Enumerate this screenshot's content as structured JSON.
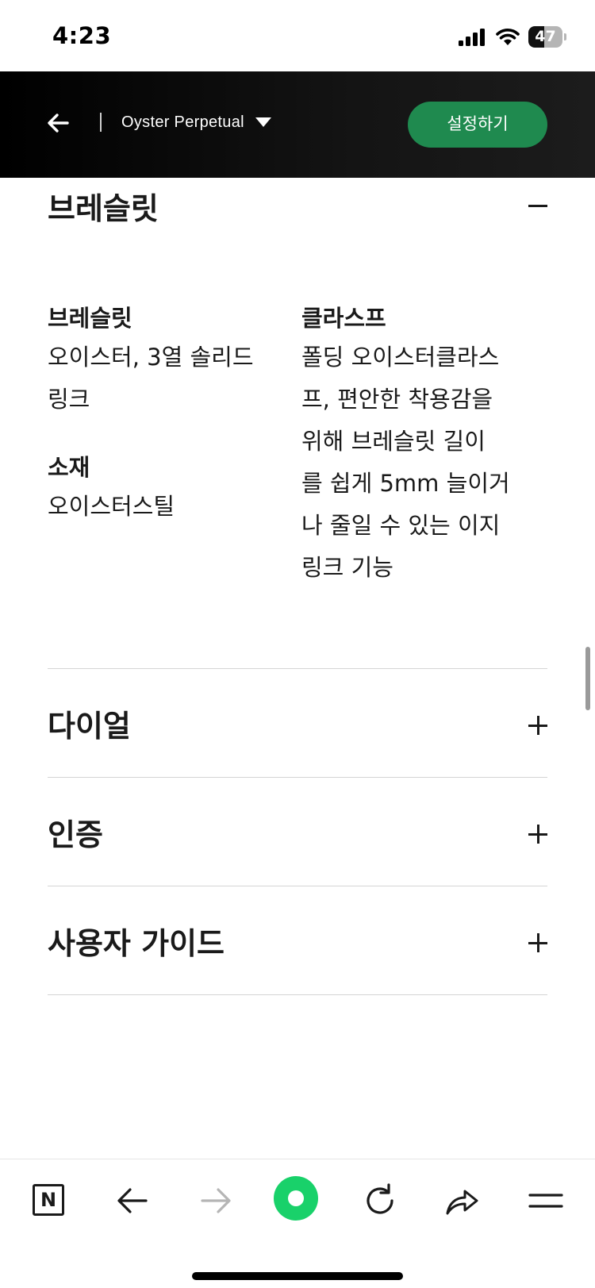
{
  "status_bar": {
    "time": "4:23",
    "battery_level": "47",
    "icons": [
      "signal-icon",
      "wifi-icon",
      "battery-icon"
    ]
  },
  "header": {
    "back_icon": "arrow-left-icon",
    "model_name": "Oyster Perpetual",
    "model_dropdown_icon": "caret-down-icon",
    "configure_label": "설정하기",
    "colors": {
      "background": "#000000",
      "button": "#1f8a4f",
      "text": "#ffffff"
    }
  },
  "bracelet_section": {
    "title": "브레슬릿",
    "toggle_icon": "minus-icon",
    "specs": {
      "bracelet": {
        "label": "브레슬릿",
        "lines": [
          "오이스터, 3열 솔리드",
          "링크"
        ]
      },
      "material": {
        "label": "소재",
        "lines": [
          "오이스터스틸"
        ]
      },
      "clasp": {
        "label": "클라스프",
        "lines": [
          "폴딩 오이스터클라스",
          "프, 편안한 착용감을",
          "위해 브레슬릿 길이",
          "를 쉽게 5mm 늘이거",
          "나 줄일 수 있는 이지",
          "링크 기능"
        ]
      }
    }
  },
  "accordion": [
    {
      "title": "다이얼",
      "icon": "plus-icon"
    },
    {
      "title": "인증",
      "icon": "plus-icon"
    },
    {
      "title": "사용자 가이드",
      "icon": "plus-icon"
    }
  ],
  "bottom_toolbar": {
    "logo_letter": "N",
    "icons": [
      "n-logo-icon",
      "back-icon",
      "forward-icon",
      "home-icon",
      "refresh-icon",
      "share-icon",
      "menu-icon"
    ],
    "colors": {
      "home": "#19d16a",
      "disabled": "#b5b5b5"
    }
  }
}
